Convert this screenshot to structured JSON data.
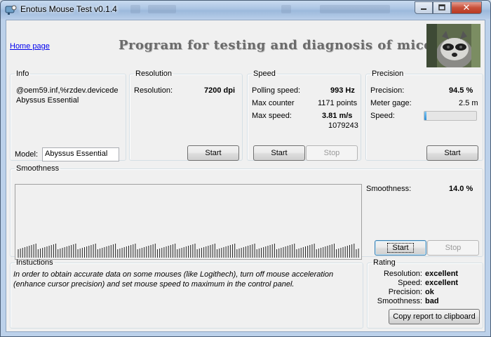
{
  "window": {
    "title": "Enotus Mouse Test v0.1.4",
    "close_glyph": "✕",
    "icons": [
      "app-icon",
      "minimize-icon",
      "maximize-icon",
      "close-icon"
    ]
  },
  "header": {
    "home_link": "Home page",
    "program_title": "Program for testing and diagnosis of mice",
    "image": "raccoon-photo"
  },
  "info": {
    "legend": "Info",
    "device_id": "@oem59.inf,%rzdev.devicede",
    "device_name": "Abyssus Essential",
    "model_label": "Model:",
    "model_value": "Abyssus Essential"
  },
  "resolution": {
    "legend": "Resolution",
    "label": "Resolution:",
    "value": "7200 dpi",
    "start": "Start"
  },
  "speed": {
    "legend": "Speed",
    "polling_label": "Polling speed:",
    "polling_value": "993 Hz",
    "max_counter_label": "Max counter",
    "max_counter_value": "1171 points",
    "max_speed_label": "Max  speed:",
    "max_speed_value": "3.81 m/s",
    "max_speed_count": "1079243",
    "start": "Start",
    "stop": "Stop"
  },
  "precision": {
    "legend": "Precision",
    "precision_label": "Precision:",
    "precision_value": "94.5 %",
    "meter_label": "Meter gage:",
    "meter_value": "2.5 m",
    "speed_label": "Speed:",
    "speed_level": 0.04,
    "start": "Start"
  },
  "smoothness": {
    "legend": "Smoothness",
    "label": "Smoothness:",
    "value": "14.0 %",
    "start": "Start",
    "stop": "Stop",
    "bar_count": 155
  },
  "instructions": {
    "legend": "Instuctions",
    "text": "In order to obtain accurate data on some mouses (like Logithech), turn off mouse acceleration (enhance cursor precision) and set mouse speed to maximum in the control panel."
  },
  "rating": {
    "legend": "Rating",
    "rows": [
      {
        "label": "Resolution:",
        "value": "excellent"
      },
      {
        "label": "Speed:",
        "value": "excellent"
      },
      {
        "label": "Precision:",
        "value": "ok"
      },
      {
        "label": "Smoothness:",
        "value": "bad"
      }
    ],
    "copy_button": "Copy report to clipboard"
  }
}
